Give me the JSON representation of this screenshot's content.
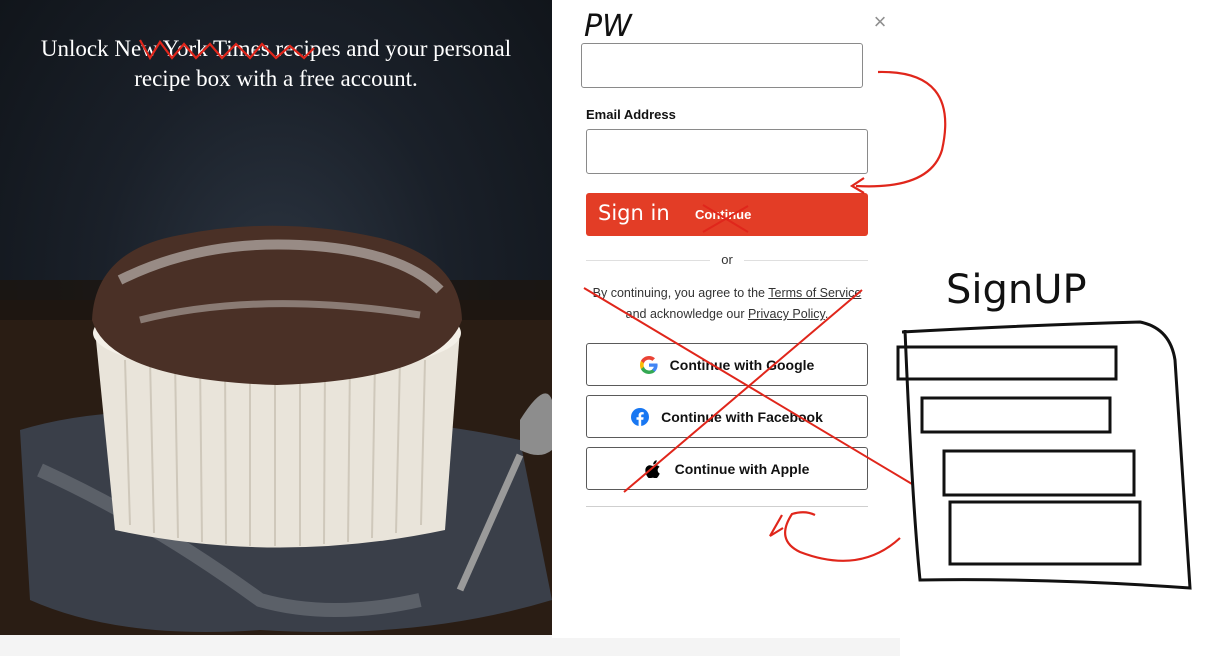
{
  "hero": {
    "title": "Unlock New York Times recipes and your personal recipe box with a free account."
  },
  "modal": {
    "close_icon": "close-icon",
    "email_label": "Email Address",
    "continue_label": "Continue",
    "or_text": "or",
    "terms_prefix": "By continuing, you agree to the ",
    "terms_link": "Terms of Service",
    "terms_middle": " and acknowledge our ",
    "privacy_link": "Privacy Policy",
    "terms_suffix": ".",
    "social": [
      {
        "label": "Continue with Google",
        "icon": "google-icon"
      },
      {
        "label": "Continue with Facebook",
        "icon": "facebook-icon"
      },
      {
        "label": "Continue with Apple",
        "icon": "apple-icon"
      }
    ]
  },
  "annotations": {
    "pw_note": "PW",
    "sign_in_note": "Sign in",
    "signup_note": "SignUP",
    "ink_color": "#e0261b"
  }
}
